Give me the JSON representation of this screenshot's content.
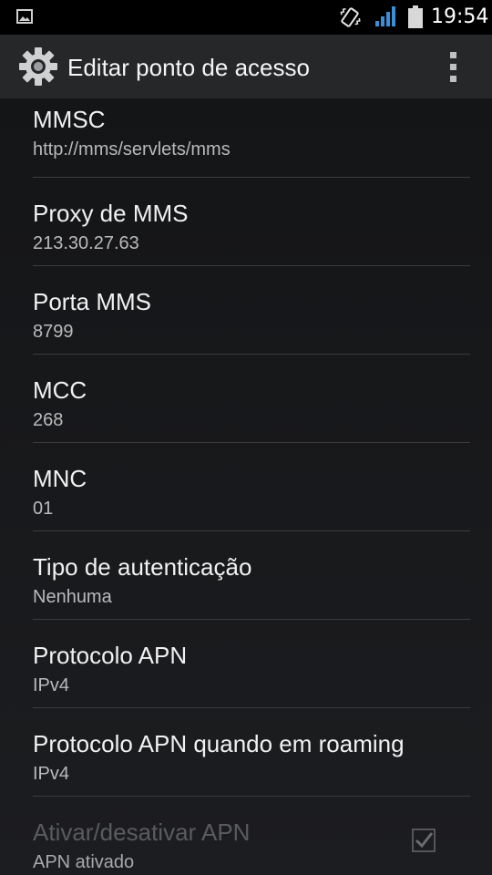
{
  "status_bar": {
    "time": "19:54",
    "icons": [
      "image-notification-icon",
      "vibrate-icon",
      "signal-icon",
      "battery-icon"
    ]
  },
  "action_bar": {
    "title": "Editar ponto de acesso",
    "icon": "settings-gear-icon",
    "overflow_icon": "overflow-menu-icon"
  },
  "colors": {
    "background": "#161719",
    "action_bar": "#262729",
    "signal_accent": "#3a8fd6",
    "divider": "#3b3c3f"
  },
  "settings": [
    {
      "title": "MMSC",
      "value": "http://mms/servlets/mms"
    },
    {
      "title": "Proxy de MMS",
      "value": "213.30.27.63"
    },
    {
      "title": "Porta MMS",
      "value": "8799"
    },
    {
      "title": "MCC",
      "value": "268"
    },
    {
      "title": "MNC",
      "value": "01"
    },
    {
      "title": "Tipo de autenticação",
      "value": "Nenhuma"
    },
    {
      "title": "Protocolo APN",
      "value": "IPv4"
    },
    {
      "title": "Protocolo APN quando em roaming",
      "value": "IPv4"
    }
  ],
  "apn_toggle": {
    "title": "Ativar/desativar APN",
    "value": "APN ativado",
    "checked": true,
    "enabled": false
  }
}
